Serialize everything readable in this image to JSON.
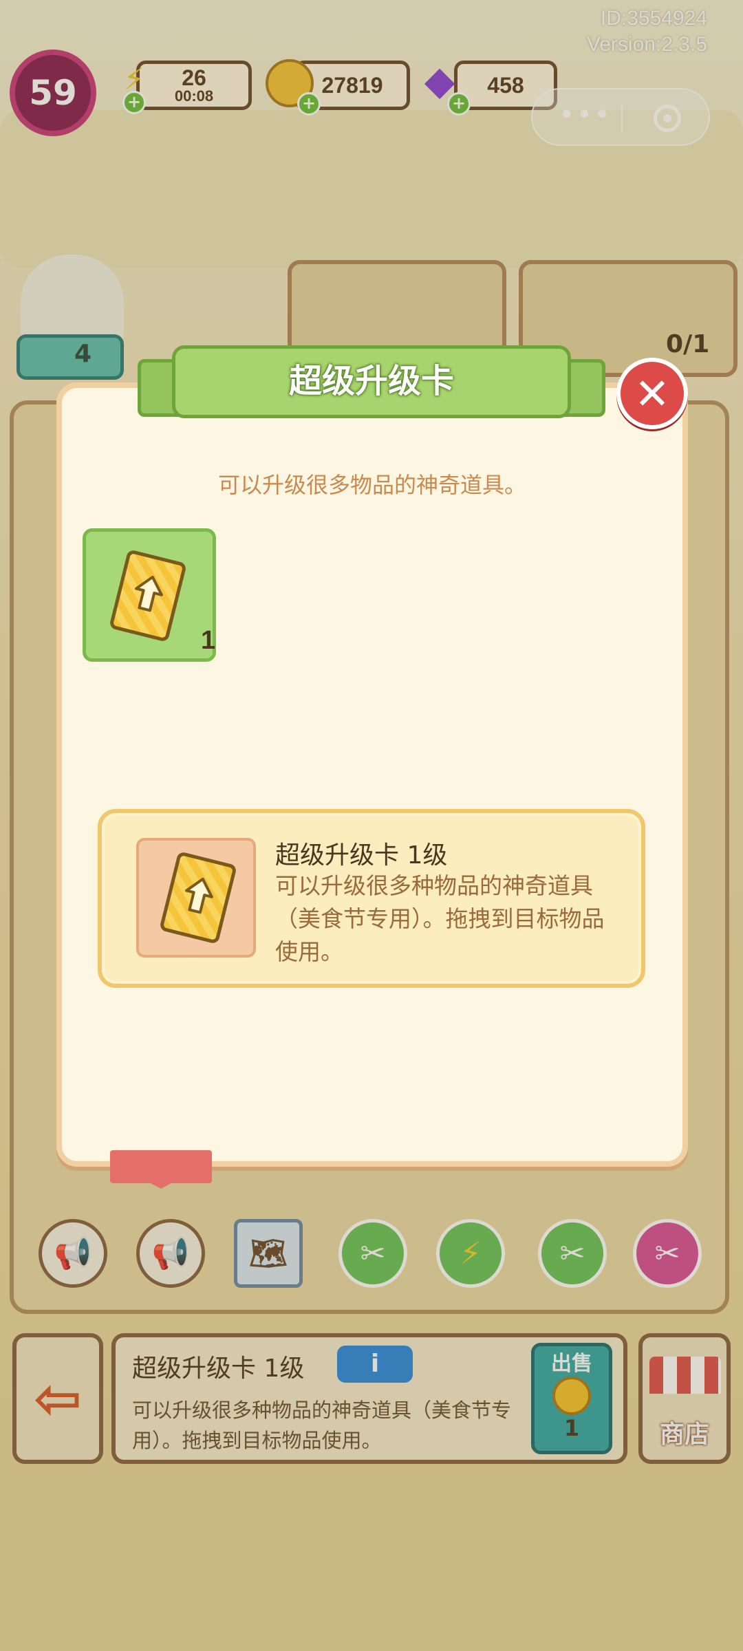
{
  "hud": {
    "id_text": "ID:3554924",
    "version_text": "Version:2.3.5",
    "level": "59",
    "energy": {
      "value": "26",
      "timer": "00:08"
    },
    "coins": "27819",
    "gems": "458"
  },
  "scene": {
    "worker_count": "4",
    "order_progress": "0/1",
    "tool_labels": [
      "出售"
    ]
  },
  "modal": {
    "title": "超级升级卡",
    "subtitle": "可以升级很多物品的神奇道具。",
    "item_count": "1",
    "detail_title": "超级升级卡  1级",
    "detail_desc": "可以升级很多种物品的神奇道具（美食节专用）。拖拽到目标物品使用。",
    "close_icon": "close-icon"
  },
  "info_bar": {
    "title": "超级升级卡 1级",
    "badge": "i",
    "desc": "可以升级很多种物品的神奇道具（美食节专用）。拖拽到目标物品使用。",
    "sell_label": "出售",
    "sell_value": "1",
    "shop_label": "商店"
  },
  "colors": {
    "ribbon_green": "#a8d46d",
    "close_red": "#dd4b48",
    "card_yellow": "#f5c43a",
    "slot_green": "#a7d878"
  }
}
